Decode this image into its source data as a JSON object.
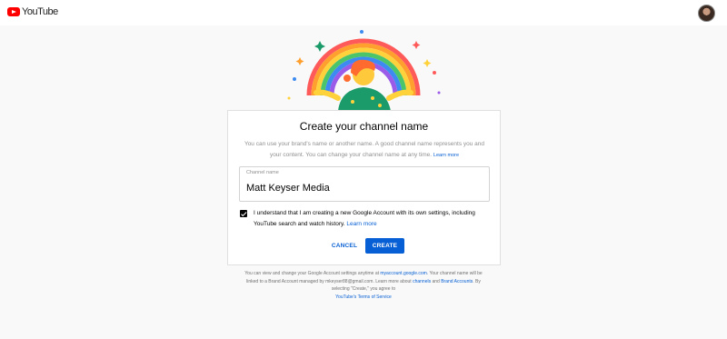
{
  "header": {
    "logo_text": "YouTube",
    "logo_icon": "youtube-play-icon",
    "avatar_icon": "account-avatar"
  },
  "dialog": {
    "title": "Create your channel name",
    "description": "You can use your brand's name or another name. A good channel name represents you and your content. You can change your channel name at any time.",
    "description_link": "Learn more",
    "field": {
      "label": "Channel name",
      "value": "Matt Keyser Media"
    },
    "checkbox": {
      "checked": true,
      "text": "I understand that I am creating a new Google Account with its own settings, including YouTube search and watch history.",
      "link": "Learn more"
    },
    "cancel_label": "CANCEL",
    "create_label": "CREATE"
  },
  "footer": {
    "text_1": "You can view and change your Google Account settings anytime at",
    "link_account": "myaccount.google.com",
    "text_2": ". Your channel name will be linked to a Brand Account managed by mkeyser88@gmail.com. Learn more about",
    "link_channels": "channels",
    "text_3": "and",
    "link_brand": "Brand Accounts",
    "text_4": ". By selecting \"Create,\" you agree to",
    "link_tos": "YouTube's Terms of Service"
  },
  "colors": {
    "accent": "#065fd4",
    "brand": "#ff0000",
    "background": "#f9f9f9"
  }
}
